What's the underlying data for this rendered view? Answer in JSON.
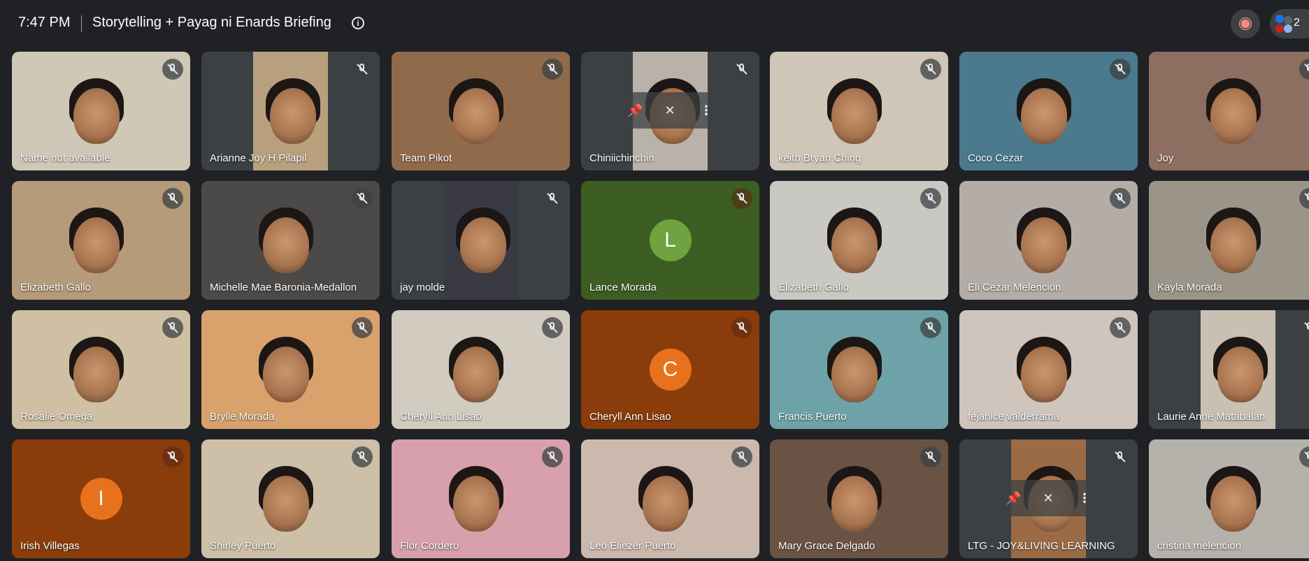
{
  "meeting": {
    "time": "7:47 PM",
    "title": "Storytelling + Payag ni Enards Briefing",
    "participant_count": "2"
  },
  "icons": {
    "info": "info-icon",
    "record": "record-icon",
    "mic_off": "mic-off-icon",
    "pin": "pin-icon",
    "more": "more-vert-icon"
  },
  "hover_controls": {
    "pin": "📌",
    "mute": "✕",
    "more": "⋮"
  },
  "tiles": [
    {
      "name": "Name not available",
      "bg": "#cfc8b6",
      "frame": ""
    },
    {
      "name": "Arianne Joy H Pilapil",
      "bg": "#3c4043",
      "frame": "#b8a07f"
    },
    {
      "name": "Team Pikot",
      "bg": "#8f6b4c",
      "frame": ""
    },
    {
      "name": "Chiniichinchin",
      "bg": "#3c4043",
      "frame": "#b9b2a8"
    },
    {
      "name": "keith Bryan Ching",
      "bg": "#cfc6b7",
      "frame": ""
    },
    {
      "name": "Coco Cezar",
      "bg": "#4b7a8f",
      "frame": ""
    },
    {
      "name": "Joy",
      "bg": "#8c6f61",
      "frame": ""
    },
    {
      "name": "Elizabeth Gallo",
      "bg": "#b59b7a",
      "frame": ""
    },
    {
      "name": "Michelle Mae Baronia-Medallon",
      "bg": "#4c4a48",
      "frame": ""
    },
    {
      "name": "jay molde",
      "bg": "#3c4043",
      "frame": "#3a3a44"
    },
    {
      "name": "Lance Morada",
      "bg": "#3c5e22",
      "frame": "",
      "initial": "L",
      "avatar": "#6fa33f"
    },
    {
      "name": "Elizabeth Gallo",
      "bg": "#c9c8c2",
      "frame": ""
    },
    {
      "name": "Eli Cezar Melencion",
      "bg": "#b4aca7",
      "frame": ""
    },
    {
      "name": "Kayla Morada",
      "bg": "#9a9588",
      "frame": ""
    },
    {
      "name": "Rosalie Omega",
      "bg": "#cfc0a3",
      "frame": ""
    },
    {
      "name": "Brylle Morada",
      "bg": "#d9a26c",
      "frame": ""
    },
    {
      "name": "Cheryll Ann Lisao",
      "bg": "#d1cbc0",
      "frame": ""
    },
    {
      "name": "Cheryll Ann Lisao",
      "bg": "#8a3c0b",
      "frame": "",
      "initial": "C",
      "avatar": "#e8711d"
    },
    {
      "name": "Francis Puerto",
      "bg": "#6da3a8",
      "frame": ""
    },
    {
      "name": "fejanice valderrama",
      "bg": "#cfc5bd",
      "frame": ""
    },
    {
      "name": "Laurie Anne Matabalan",
      "bg": "#3c4043",
      "frame": "#c9c0b3"
    },
    {
      "name": "Irish Villegas",
      "bg": "#8a3c0b",
      "frame": "",
      "initial": "I",
      "avatar": "#e8711d"
    },
    {
      "name": "Shirley Puerto",
      "bg": "#cdbfa8",
      "frame": ""
    },
    {
      "name": "Flor Cordero",
      "bg": "#d7a0ac",
      "frame": ""
    },
    {
      "name": "Leo Eliezer Puerto",
      "bg": "#cbb9ad",
      "frame": ""
    },
    {
      "name": "Mary Grace Delgado",
      "bg": "#6a5345",
      "frame": ""
    },
    {
      "name": "LTG - JOY&LIVING LEARNING",
      "bg": "#3c4043",
      "frame": "#9a6b45"
    },
    {
      "name": "cristina melencion",
      "bg": "#b5b1ab",
      "frame": "",
      "active": true
    }
  ]
}
